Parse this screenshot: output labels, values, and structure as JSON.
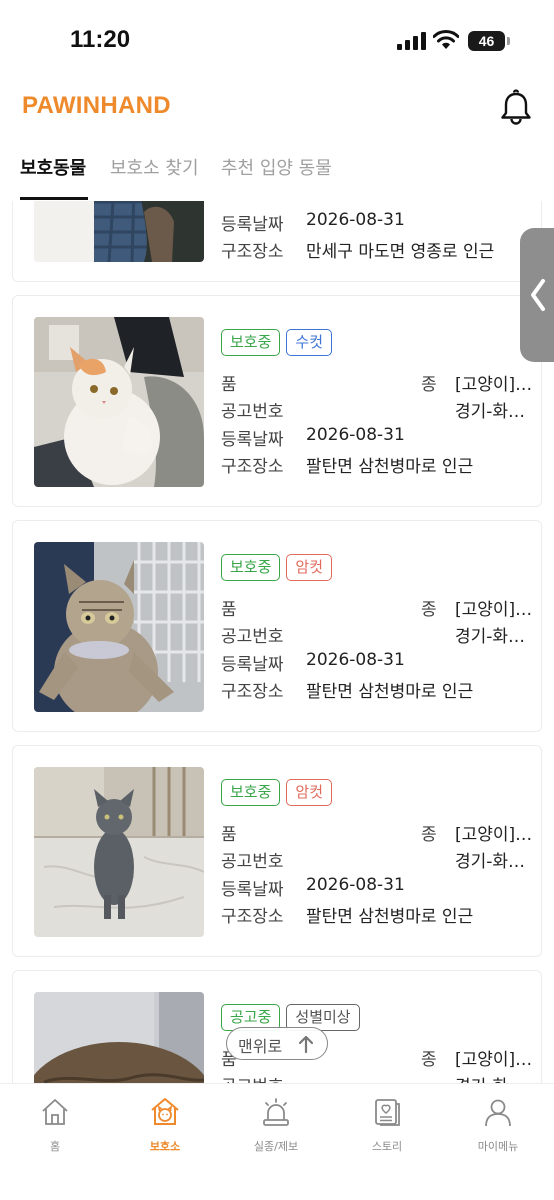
{
  "status_bar": {
    "time": "11:20",
    "battery": "46",
    "battery_level": 0.46,
    "icons": [
      "signal-icon",
      "wifi-icon",
      "battery-icon"
    ]
  },
  "header": {
    "logo": "PAWINHAND",
    "icons": [
      "bell-icon"
    ],
    "accent_color": "#ee8a2c"
  },
  "tabs": [
    {
      "label": "보호동물",
      "active": true
    },
    {
      "label": "보호소 찾기",
      "active": false
    },
    {
      "label": "추천 입양 동물",
      "active": false
    }
  ],
  "labels": {
    "species": "품",
    "species_key": "종",
    "notice": "공고번호",
    "date": "등록날짜",
    "place": "구조장소"
  },
  "cards": [
    {
      "badges": [],
      "species": "",
      "notice": "",
      "date": "2026-08-31",
      "place": "만세구 마도면 영종로 인근"
    },
    {
      "badges": [
        {
          "text": "보호중",
          "color": "#3aa64a"
        },
        {
          "text": "수컷",
          "color": "#3e74d6"
        }
      ],
      "species": "[고양이]…",
      "notice": "경기-화…",
      "date": "2026-08-31",
      "place": "팔탄면 삼천병마로 인근"
    },
    {
      "badges": [
        {
          "text": "보호중",
          "color": "#3aa64a"
        },
        {
          "text": "암컷",
          "color": "#e06b5c"
        }
      ],
      "species": "[고양이]…",
      "notice": "경기-화…",
      "date": "2026-08-31",
      "place": "팔탄면 삼천병마로 인근"
    },
    {
      "badges": [
        {
          "text": "보호중",
          "color": "#3aa64a"
        },
        {
          "text": "암컷",
          "color": "#e06b5c"
        }
      ],
      "species": "[고양이]…",
      "notice": "경기-화…",
      "date": "2026-08-31",
      "place": "팔탄면 삼천병마로 인근"
    },
    {
      "badges": [
        {
          "text": "공고중",
          "color": "#3aa64a"
        },
        {
          "text": "성별미상",
          "color": "#555555"
        }
      ],
      "species": "[고양이]…",
      "notice": "경기-화",
      "date": "",
      "place": ""
    }
  ],
  "scroll_top": {
    "label": "맨위로",
    "icon": "arrow-up-icon"
  },
  "side_handle": {
    "icon": "chevron-left-icon"
  },
  "bottom_nav": [
    {
      "label": "홈",
      "icon": "home-icon",
      "active": false
    },
    {
      "label": "보호소",
      "icon": "shelter-icon",
      "active": true
    },
    {
      "label": "실종/제보",
      "icon": "siren-icon",
      "active": false
    },
    {
      "label": "스토리",
      "icon": "story-icon",
      "active": false
    },
    {
      "label": "마이메뉴",
      "icon": "profile-icon",
      "active": false
    }
  ]
}
